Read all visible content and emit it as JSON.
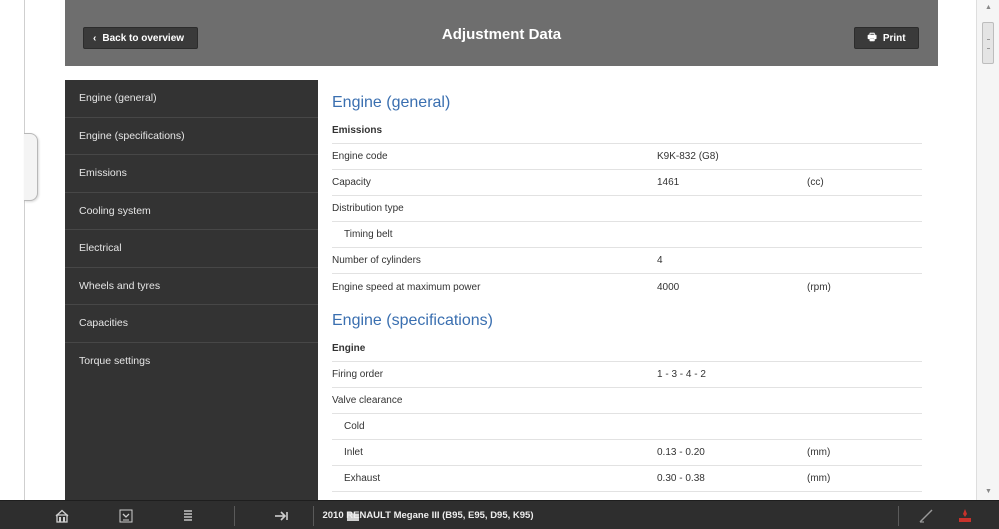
{
  "header": {
    "back_label": "Back to overview",
    "title": "Adjustment Data",
    "print_label": "Print"
  },
  "sidebar": {
    "items": [
      {
        "label": "Engine (general)"
      },
      {
        "label": "Engine (specifications)"
      },
      {
        "label": "Emissions"
      },
      {
        "label": "Cooling system"
      },
      {
        "label": "Electrical"
      },
      {
        "label": "Wheels and tyres"
      },
      {
        "label": "Capacities"
      },
      {
        "label": "Torque settings"
      }
    ]
  },
  "content": {
    "sections": [
      {
        "title": "Engine (general)",
        "subheading": "Emissions",
        "rows": [
          {
            "label": "Engine code",
            "value": "K9K-832 (G8)",
            "unit": ""
          },
          {
            "label": "Capacity",
            "value": "1461",
            "unit": "(cc)"
          },
          {
            "label": "Distribution type",
            "value": "",
            "unit": ""
          },
          {
            "label": "Timing belt",
            "value": "",
            "unit": ""
          },
          {
            "label": "Number of cylinders",
            "value": "4",
            "unit": ""
          },
          {
            "label": "Engine speed at maximum power",
            "value": "4000",
            "unit": "(rpm)"
          }
        ]
      },
      {
        "title": "Engine (specifications)",
        "subheading": "Engine",
        "rows": [
          {
            "label": "Firing order",
            "value": "1 - 3 - 4 - 2",
            "unit": ""
          },
          {
            "label": "Valve clearance",
            "value": "",
            "unit": ""
          },
          {
            "label": "Cold",
            "value": "",
            "unit": ""
          },
          {
            "label": "Inlet",
            "value": "0.13 - 0.20",
            "unit": "(mm)"
          },
          {
            "label": "Exhaust",
            "value": "0.30 - 0.38",
            "unit": "(mm)"
          }
        ]
      }
    ]
  },
  "footer": {
    "vehicle": "2010 RENAULT Megane III (B95, E95, D95, K95)",
    "icons": [
      "home-icon",
      "expand-icon",
      "collapse-icon",
      "forward-icon",
      "folder-icon",
      "edit-icon",
      "tool-icon"
    ]
  },
  "colors": {
    "header_bg": "#6e6e6e",
    "sidebar_bg": "#333333",
    "title_blue": "#3a6fb0",
    "footer_bg": "#2e2e2e",
    "accent_red": "#c8322b"
  }
}
